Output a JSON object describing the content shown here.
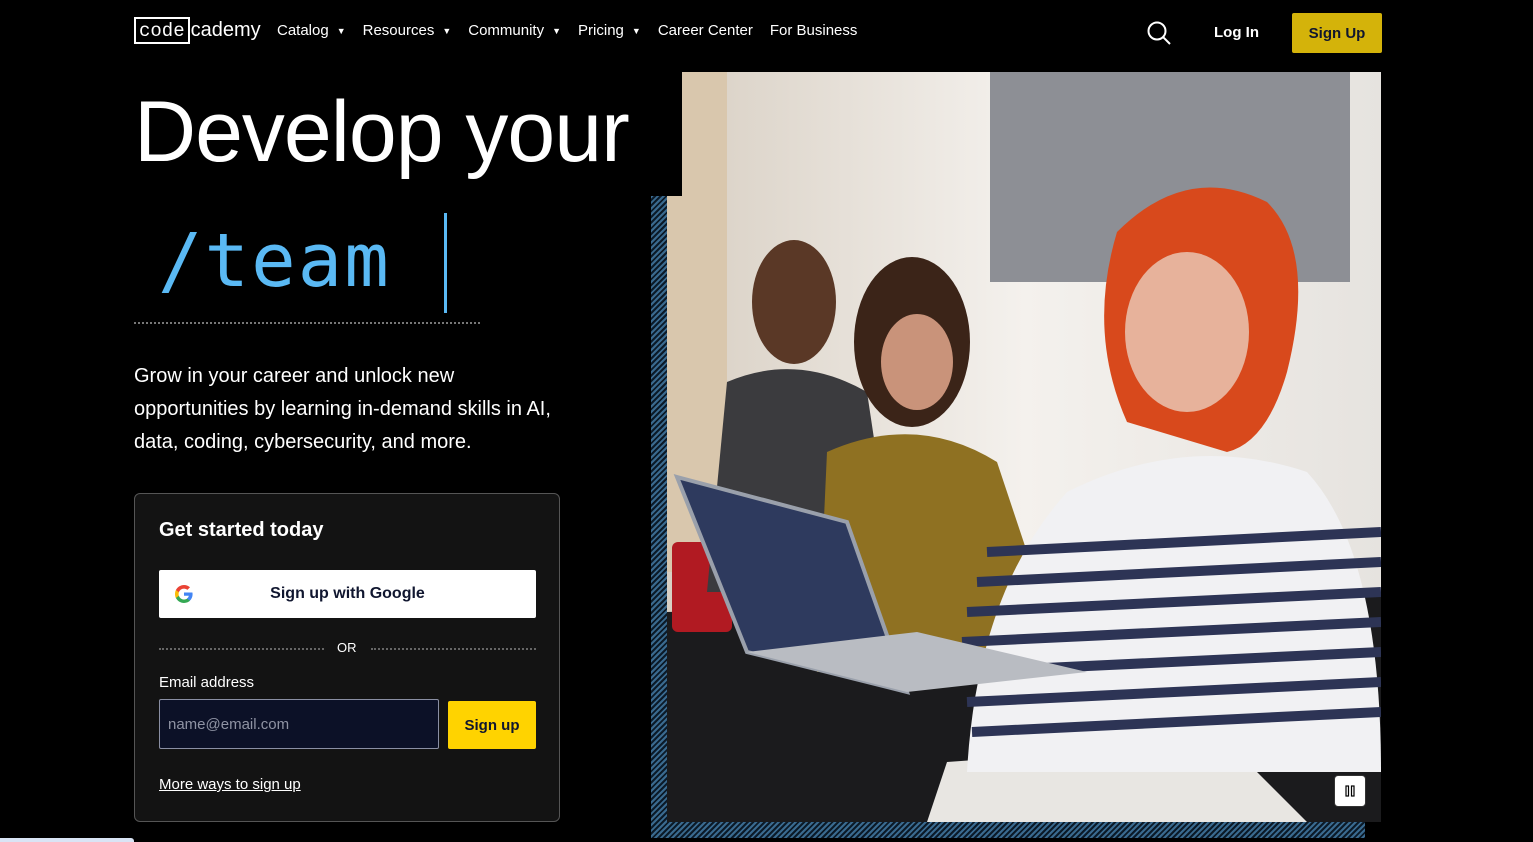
{
  "nav": {
    "logo_code": "code",
    "logo_cademy": "cademy",
    "items": [
      {
        "label": "Catalog",
        "has_dropdown": true
      },
      {
        "label": "Resources",
        "has_dropdown": true
      },
      {
        "label": "Community",
        "has_dropdown": true
      },
      {
        "label": "Pricing",
        "has_dropdown": true
      },
      {
        "label": "Career Center",
        "has_dropdown": false
      },
      {
        "label": "For Business",
        "has_dropdown": false
      }
    ],
    "caret": "▼",
    "search_icon": "search-icon",
    "login": "Log In",
    "signup": "Sign Up"
  },
  "hero": {
    "headline": "Develop your",
    "typed_word": "/team",
    "subcopy": "Grow in your career and unlock new opportunities by learning in-demand skills in AI, data, coding, cybersecurity, and more."
  },
  "signup_card": {
    "title": "Get started today",
    "google_button": "Sign up with Google",
    "or_text": "OR",
    "email_label": "Email address",
    "email_placeholder": "name@email.com",
    "email_value": "",
    "signup_button": "Sign up",
    "more_ways": "More ways to sign up"
  },
  "media": {
    "pause_icon": "pause-icon"
  },
  "colors": {
    "accent_yellow": "#ffd300",
    "nav_signup_yellow": "#d4b30a",
    "typed_blue": "#5ab9f4",
    "navy": "#10162f"
  }
}
